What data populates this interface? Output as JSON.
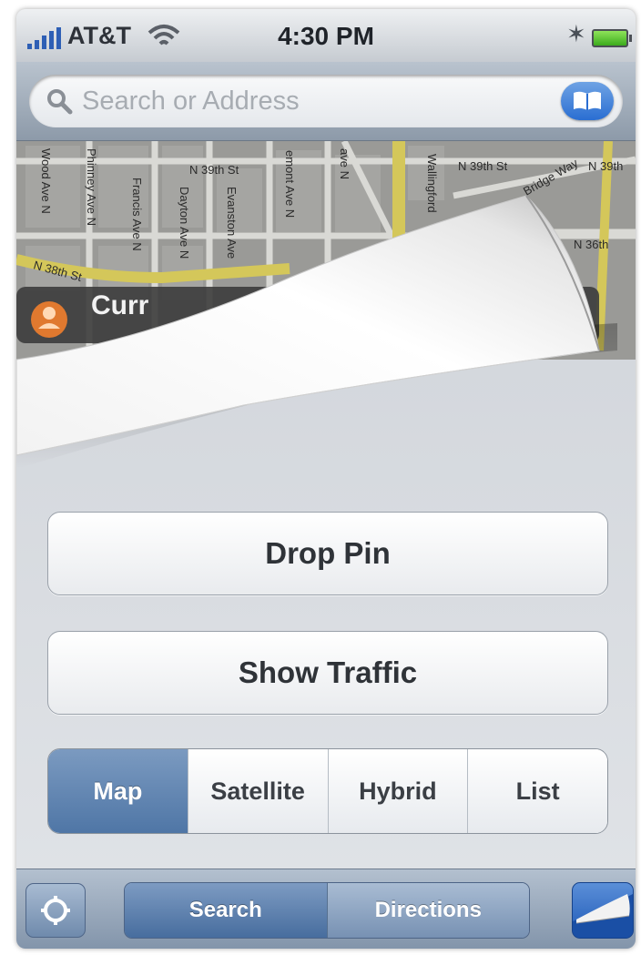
{
  "status_bar": {
    "carrier": "AT&T",
    "time": "4:30 PM"
  },
  "search": {
    "placeholder": "Search or Address"
  },
  "map": {
    "street_labels": [
      "N 39th St",
      "N 39th St",
      "N 39th",
      "N 36th",
      "N 38th St",
      "Phinney Ave N",
      "Francis Ave N",
      "Dayton Ave N",
      "Evanston Ave",
      "emont Ave N",
      "ave N",
      "Wood Ave N",
      "Wallingford",
      "Bridge Way"
    ],
    "callout_text": "Curr"
  },
  "actions": {
    "drop_pin": "Drop Pin",
    "show_traffic": "Show Traffic"
  },
  "map_type_segments": [
    {
      "label": "Map",
      "selected": true
    },
    {
      "label": "Satellite",
      "selected": false
    },
    {
      "label": "Hybrid",
      "selected": false
    },
    {
      "label": "List",
      "selected": false
    }
  ],
  "toolbar": {
    "search_label": "Search",
    "directions_label": "Directions"
  },
  "colors": {
    "selected_segment": "#5b7fac",
    "toolbar": "#8a9cb2",
    "accent_blue": "#2a6ed2"
  },
  "icons": {
    "search": "magnifier",
    "bookmarks": "open-book",
    "locate": "crosshair",
    "page_curl": "page-curl",
    "bluetooth": "bluetooth",
    "wifi": "wifi-arcs",
    "battery": "battery"
  }
}
